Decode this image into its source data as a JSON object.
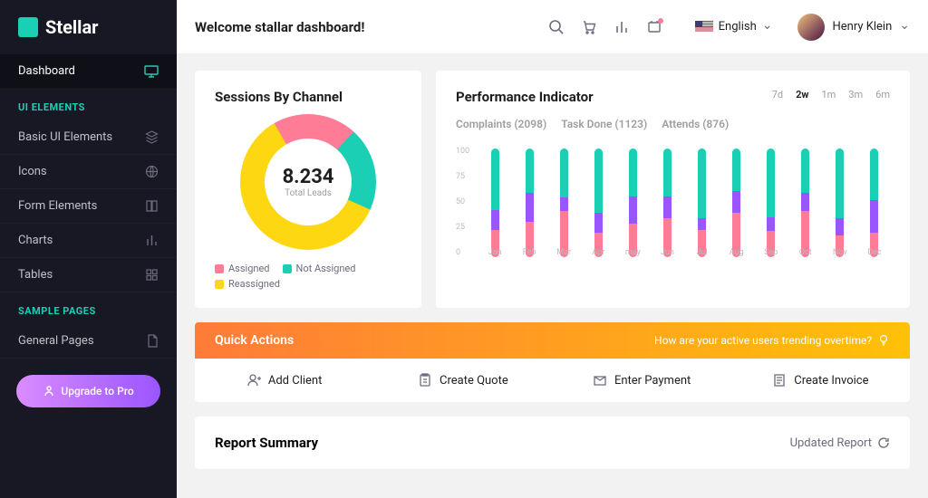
{
  "brand": "Stellar",
  "topbar": {
    "welcome": "Welcome stallar dashboard!",
    "language": "English",
    "user": "Henry Klein"
  },
  "sidebar": {
    "dashboard": "Dashboard",
    "ui_header": "UI ELEMENTS",
    "items": [
      {
        "label": "Basic UI Elements"
      },
      {
        "label": "Icons"
      },
      {
        "label": "Form Elements"
      },
      {
        "label": "Charts"
      },
      {
        "label": "Tables"
      }
    ],
    "sample_header": "SAMPLE PAGES",
    "general": "General Pages",
    "upgrade": "Upgrade to Pro"
  },
  "sessions": {
    "title": "Sessions By Channel",
    "value": "8.234",
    "value_label": "Total Leads",
    "legend": [
      {
        "label": "Assigned",
        "color": "#fe7c96"
      },
      {
        "label": "Not Assigned",
        "color": "#1bcfb4"
      },
      {
        "label": "Reassigned",
        "color": "#fed713"
      }
    ]
  },
  "chart_data": [
    {
      "type": "pie",
      "title": "Sessions By Channel",
      "series": [
        {
          "name": "Assigned",
          "value": 20,
          "color": "#fe7c96"
        },
        {
          "name": "Not Assigned",
          "value": 20,
          "color": "#1bcfb4"
        },
        {
          "name": "Reassigned",
          "value": 60,
          "color": "#fed713"
        }
      ]
    },
    {
      "type": "bar",
      "title": "Performance Indicator",
      "ylim": [
        0,
        100
      ],
      "yticks": [
        0,
        25,
        50,
        75,
        100
      ],
      "categories": [
        "Jan",
        "Feb",
        "Mar",
        "Apr",
        "may",
        "Jun",
        "Jul",
        "Aug",
        "Sep",
        "Oct",
        "Nov",
        "Dec"
      ],
      "series": [
        {
          "name": "Complaints",
          "color": "#fe7c96",
          "values": [
            25,
            32,
            42,
            22,
            30,
            35,
            25,
            40,
            24,
            42,
            20,
            22
          ]
        },
        {
          "name": "Task Done",
          "color": "#9a55ff",
          "values": [
            18,
            26,
            12,
            18,
            25,
            20,
            10,
            20,
            12,
            16,
            15,
            30
          ]
        },
        {
          "name": "Attends",
          "color": "#1bcfb4",
          "values": [
            55,
            40,
            44,
            58,
            43,
            43,
            63,
            38,
            62,
            40,
            63,
            46
          ]
        }
      ]
    }
  ],
  "perf": {
    "title": "Performance Indicator",
    "ranges": [
      "7d",
      "2w",
      "1m",
      "3m",
      "6m"
    ],
    "active_range": "2w",
    "subs": [
      "Complaints (2098)",
      "Task Done (1123)",
      "Attends (876)"
    ]
  },
  "quick": {
    "title": "Quick Actions",
    "hint": "How are your active users trending overtime?",
    "items": [
      {
        "label": "Add Client"
      },
      {
        "label": "Create Quote"
      },
      {
        "label": "Enter Payment"
      },
      {
        "label": "Create Invoice"
      }
    ]
  },
  "summary": {
    "title": "Report Summary",
    "updated": "Updated Report"
  }
}
